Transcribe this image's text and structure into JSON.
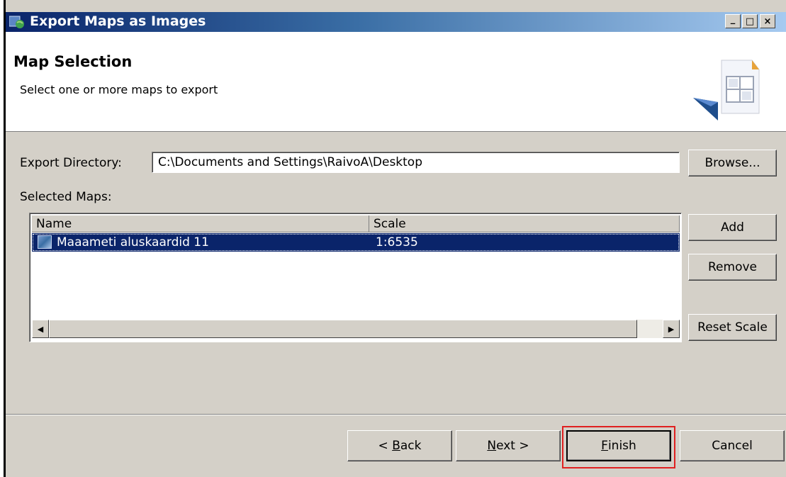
{
  "window": {
    "title": "Export Maps as Images",
    "minimize_glyph": "_",
    "maximize_glyph": "□",
    "close_glyph": "×"
  },
  "header": {
    "title": "Map Selection",
    "description": "Select one or more maps to export",
    "icon": "export-image-wizard-icon"
  },
  "export_directory": {
    "label": "Export Directory:",
    "value": "C:\\Documents and Settings\\RaivoA\\Desktop",
    "browse_label": "Browse..."
  },
  "selected_maps": {
    "label": "Selected Maps:",
    "columns": [
      "Name",
      "Scale"
    ],
    "rows": [
      {
        "name": "Maaameti aluskaardid 11",
        "scale": "1:6535",
        "selected": true,
        "icon": "map-icon"
      }
    ]
  },
  "side_buttons": {
    "add": "Add",
    "remove": "Remove",
    "reset_scale": "Reset Scale"
  },
  "footer": {
    "back": {
      "prefix": "< ",
      "mnemonic": "B",
      "rest": "ack"
    },
    "next": {
      "mnemonic": "N",
      "rest": "ext >"
    },
    "finish": {
      "mnemonic": "F",
      "rest": "inish"
    },
    "cancel": "Cancel"
  },
  "colors": {
    "selection": "#0a246a",
    "dialog_bg": "#d4d0c8",
    "highlight": "#e02020"
  }
}
